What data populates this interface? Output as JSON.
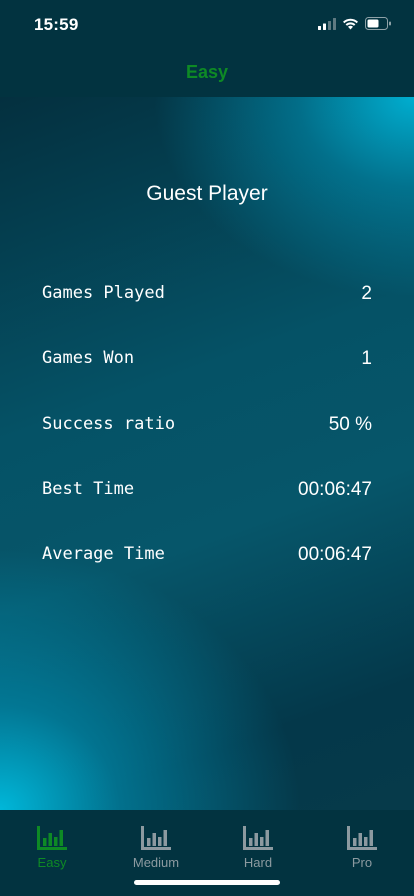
{
  "status_bar": {
    "time": "15:59"
  },
  "nav": {
    "title": "Easy"
  },
  "profile": {
    "player_name": "Guest Player"
  },
  "stats": [
    {
      "label": "Games Played",
      "value": "2"
    },
    {
      "label": "Games Won",
      "value": "1"
    },
    {
      "label": "Success ratio",
      "value": "50 %"
    },
    {
      "label": "Best Time",
      "value": "00:06:47"
    },
    {
      "label": "Average Time",
      "value": "00:06:47"
    }
  ],
  "tabs": [
    {
      "label": "Easy",
      "icon": "bar-chart-icon",
      "active": true
    },
    {
      "label": "Medium",
      "icon": "bar-chart-icon",
      "active": false
    },
    {
      "label": "Hard",
      "icon": "bar-chart-icon",
      "active": false
    },
    {
      "label": "Pro",
      "icon": "bar-chart-icon",
      "active": false
    }
  ],
  "colors": {
    "active_tab": "#0e8a25",
    "inactive_tab": "#8c9aa0",
    "nav_title": "#0e8a25",
    "background": "#023340"
  }
}
